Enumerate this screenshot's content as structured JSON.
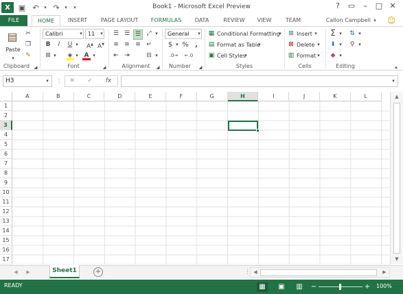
{
  "title": "Book1 - Microsoft Excel Preview",
  "tabs": {
    "file": "FILE",
    "home": "HOME",
    "insert": "INSERT",
    "page_layout": "PAGE LAYOUT",
    "formulas": "FORMULAS",
    "data": "DATA",
    "review": "REVIEW",
    "view": "VIEW",
    "team": "TEAM"
  },
  "user": "Callon Campbell",
  "help": "?",
  "clipboard": {
    "paste": "Paste",
    "label": "Clipboard"
  },
  "font": {
    "name": "Calibri",
    "size": "11",
    "bold": "B",
    "italic": "I",
    "underline": "U",
    "label": "Font"
  },
  "alignment": {
    "label": "Alignment"
  },
  "number": {
    "format": "General",
    "currency": "$",
    "percent": "%",
    "comma": ",",
    "label": "Number"
  },
  "styles": {
    "conditional": "Conditional Formatting",
    "table": "Format as Table",
    "cell": "Cell Styles",
    "label": "Styles"
  },
  "cells": {
    "insert": "Insert",
    "delete": "Delete",
    "format": "Format",
    "label": "Cells"
  },
  "editing": {
    "label": "Editing"
  },
  "formula_bar": {
    "name_box": "H3",
    "cancel": "✕",
    "enter": "✓",
    "fx": "fx",
    "value": ""
  },
  "columns": [
    "A",
    "B",
    "C",
    "D",
    "E",
    "F",
    "G",
    "H",
    "I",
    "J",
    "K",
    "L"
  ],
  "rows": [
    "1",
    "2",
    "3",
    "4",
    "5",
    "6",
    "7",
    "8",
    "9",
    "10",
    "11",
    "12",
    "13",
    "14",
    "15",
    "16",
    "17"
  ],
  "active_column": "H",
  "active_row": "3",
  "sheet": {
    "name": "Sheet1",
    "add": "+"
  },
  "status": {
    "text": "READY",
    "zoom": "100%",
    "zoom_minus": "−",
    "zoom_plus": "+"
  },
  "colors": {
    "accent": "#217346",
    "active_header": "#e1e1e1"
  }
}
